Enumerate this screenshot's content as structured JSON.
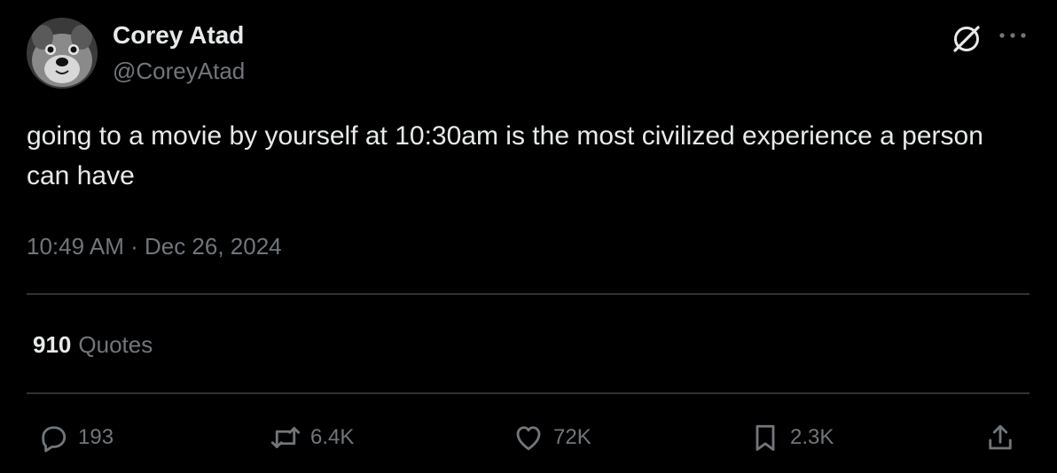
{
  "author": {
    "display_name": "Corey Atad",
    "handle": "@CoreyAtad"
  },
  "tweet": {
    "text": "going to a movie by yourself at 10:30am is the most civilized experience a person can have",
    "timestamp": "10:49 AM · Dec 26, 2024"
  },
  "quotes": {
    "count": "910",
    "label": "Quotes"
  },
  "actions": {
    "reply_count": "193",
    "retweet_count": "6.4K",
    "like_count": "72K",
    "bookmark_count": "2.3K"
  },
  "icons": {
    "grok": "grok-icon",
    "more": "more-options-icon",
    "reply": "reply-icon",
    "retweet": "retweet-icon",
    "like": "heart-icon",
    "bookmark": "bookmark-icon",
    "share": "share-icon"
  },
  "colors": {
    "background": "#000000",
    "primary_text": "#e7e9ea",
    "secondary_text": "#71767b",
    "divider": "#2f3336"
  }
}
